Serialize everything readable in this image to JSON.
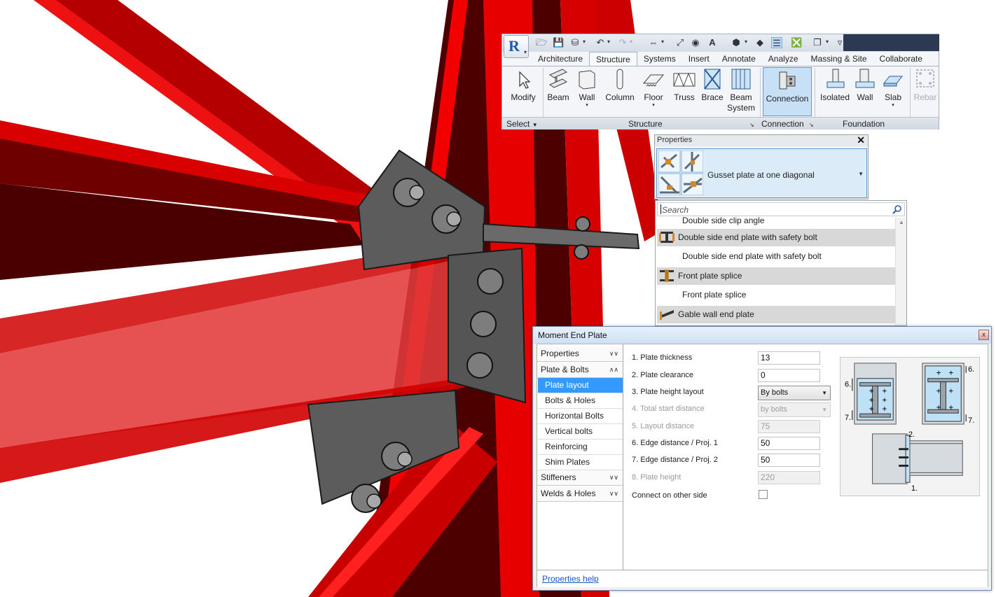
{
  "colors": {
    "steel_red": "#e00000",
    "steel_dark": "#5a0000",
    "plate_gray": "#5f5f5f",
    "selection_blue": "#3399ff",
    "link_blue": "#1a56c8"
  },
  "ribbon": {
    "app_logo": "R",
    "quick_access_icons": [
      "open-icon",
      "save-icon",
      "sync-icon",
      "undo-icon",
      "redo-icon",
      "measure-icon",
      "dimension-icon",
      "text-icon",
      "3d-view-icon",
      "section-icon",
      "thin-lines-icon",
      "close-windows-icon",
      "switch-windows-icon",
      "customize-icon"
    ],
    "tabs": [
      {
        "label": "Architecture"
      },
      {
        "label": "Structure"
      },
      {
        "label": "Systems"
      },
      {
        "label": "Insert"
      },
      {
        "label": "Annotate"
      },
      {
        "label": "Analyze"
      },
      {
        "label": "Massing & Site"
      },
      {
        "label": "Collaborate"
      }
    ],
    "active_tab": "Structure",
    "tools": {
      "modify": "Modify",
      "beam": "Beam",
      "wall": "Wall",
      "column": "Column",
      "floor": "Floor",
      "truss": "Truss",
      "brace": "Brace",
      "beam_system_1": "Beam",
      "beam_system_2": "System",
      "connection": "Connection",
      "isolated": "Isolated",
      "fwall": "Wall",
      "slab": "Slab",
      "rebar": "Rebar"
    },
    "panels": {
      "select": "Select",
      "structure": "Structure",
      "connection": "Connection",
      "foundation": "Foundation"
    }
  },
  "properties": {
    "title": "Properties",
    "close": "✕",
    "type_name": "Gusset plate at one diagonal"
  },
  "dropdown": {
    "search_placeholder": "Search",
    "rows": [
      {
        "kind": "item",
        "label": "Double side clip angle"
      },
      {
        "kind": "group",
        "label": "Double side end plate with safety bolt"
      },
      {
        "kind": "item",
        "label": "Double side end plate with safety bolt"
      },
      {
        "kind": "group",
        "label": "Front plate splice"
      },
      {
        "kind": "item",
        "label": "Front plate splice"
      },
      {
        "kind": "group",
        "label": "Gable wall end plate"
      }
    ]
  },
  "dialog": {
    "title": "Moment End Plate",
    "close": "x",
    "nav": {
      "properties": "Properties",
      "plate_bolts": "Plate & Bolts",
      "plate_layout": "Plate layout",
      "bolts_holes": "Bolts & Holes",
      "horizontal_bolts": "Horizontal Bolts",
      "vertical_bolts": "Vertical bolts",
      "reinforcing": "Reinforcing",
      "shim_plates": "Shim Plates",
      "stiffeners": "Stiffeners",
      "welds_holes": "Welds & Holes"
    },
    "fields": [
      {
        "label": "1. Plate thickness",
        "value": "13"
      },
      {
        "label": "2. Plate clearance",
        "value": "0"
      },
      {
        "label": "3. Plate height layout",
        "value": "By bolts"
      },
      {
        "label": "4. Total start distance",
        "value": "by bolts"
      },
      {
        "label": "5. Layout distance",
        "value": "75"
      },
      {
        "label": "6. Edge distance / Proj. 1",
        "value": "50"
      },
      {
        "label": "7. Edge distance / Proj. 2",
        "value": "50"
      },
      {
        "label": "8. Plate height",
        "value": "220"
      },
      {
        "label": "Connect on other side",
        "checked": false
      }
    ],
    "preview_labels": {
      "label_6a": "6.",
      "label_7a": "7.",
      "label_6b": "6.",
      "label_7b": "7.",
      "label_2": "2.",
      "label_1": "1."
    },
    "help": "Properties help"
  }
}
